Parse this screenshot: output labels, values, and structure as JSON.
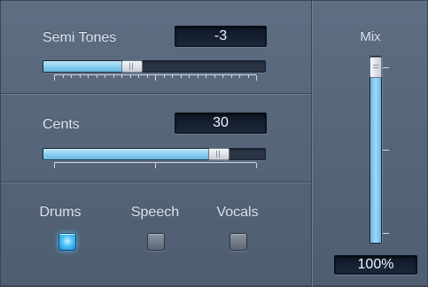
{
  "semitones": {
    "label": "Semi Tones",
    "value": "-3",
    "fill_fraction": 0.4
  },
  "cents": {
    "label": "Cents",
    "value": "30",
    "fill_fraction": 0.79
  },
  "mode": {
    "buttons": [
      {
        "label": "Drums",
        "active": true
      },
      {
        "label": "Speech",
        "active": false
      },
      {
        "label": "Vocals",
        "active": false
      }
    ]
  },
  "mix": {
    "label": "Mix",
    "value": "100%",
    "fill_fraction": 1.0
  },
  "colors": {
    "accent": "#86cdf1",
    "active_button": "#4ac2f7",
    "panel": "#566579"
  }
}
